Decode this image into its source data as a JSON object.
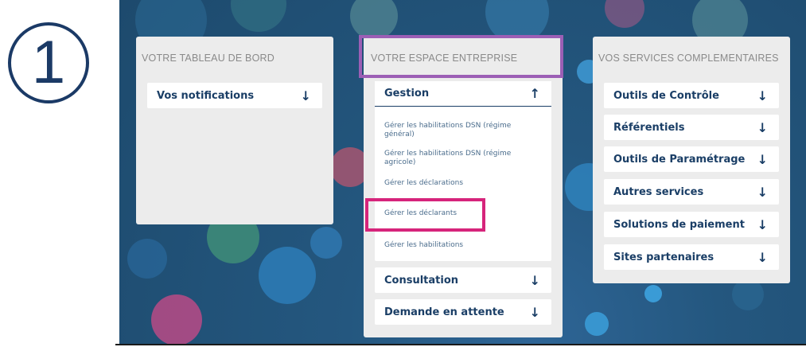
{
  "step_number": "1",
  "panels": {
    "dashboard": {
      "title": "VOTRE TABLEAU DE BORD",
      "items": [
        {
          "label": "Vos notifications",
          "arrow": "↓"
        }
      ]
    },
    "enterprise": {
      "title": "VOTRE ESPACE ENTREPRISE",
      "gestion": {
        "label": "Gestion",
        "arrow": "↑",
        "links": [
          "Gérer les habilitations DSN (régime général)",
          "Gérer les habilitations DSN (régime agricole)",
          "Gérer les déclarations",
          "Gérer les déclarants",
          "Gérer les habilitations"
        ]
      },
      "consultation": {
        "label": "Consultation",
        "arrow": "↓"
      },
      "pending": {
        "label": "Demande en attente",
        "arrow": "↓"
      }
    },
    "services": {
      "title": "VOS SERVICES COMPLEMENTAIRES",
      "items": [
        {
          "label": "Outils de Contrôle",
          "arrow": "↓"
        },
        {
          "label": "Référentiels",
          "arrow": "↓"
        },
        {
          "label": "Outils de Paramétrage",
          "arrow": "↓"
        },
        {
          "label": "Autres services",
          "arrow": "↓"
        },
        {
          "label": "Solutions de paiement",
          "arrow": "↓"
        },
        {
          "label": "Sites partenaires",
          "arrow": "↓"
        }
      ]
    }
  },
  "highlights": {
    "panel_title_color": "#9c5fb5",
    "target_link_color": "#d6247b"
  },
  "colors": {
    "background": "#1d4a6d",
    "text": "#1a3e66",
    "panel": "#ececec"
  }
}
